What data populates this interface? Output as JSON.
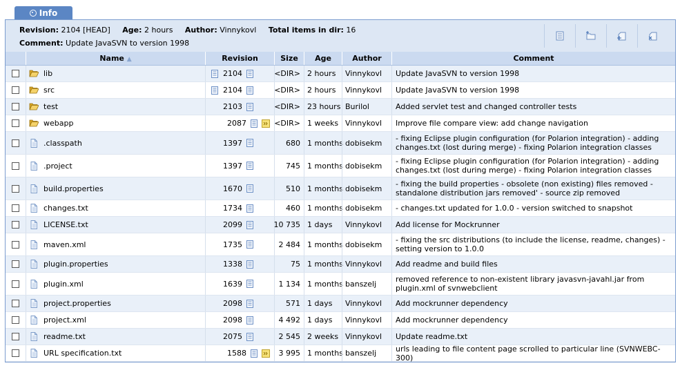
{
  "tab": {
    "label": "Info"
  },
  "info": {
    "revision_label": "Revision:",
    "revision_value": "2104 [HEAD]",
    "age_label": "Age:",
    "age_value": "2 hours",
    "author_label": "Author:",
    "author_value": "Vinnykovl",
    "total_label": "Total items in dir:",
    "total_value": "16",
    "comment_label": "Comment:",
    "comment_value": "Update JavaSVN to version 1998"
  },
  "toolbar": [
    "list-icon",
    "folder-add-icon",
    "file-add-icon",
    "delete-icon"
  ],
  "columns": {
    "name": "Name",
    "revision": "Revision",
    "size": "Size",
    "age": "Age",
    "author": "Author",
    "comment": "Comment"
  },
  "colors": {
    "accent": "#5b86c4",
    "header": "#cbdaf0",
    "alt_row": "#e9f0f9",
    "folder": "#e9c24a"
  },
  "rows": [
    {
      "type": "dir",
      "name": "lib",
      "revision": "2104",
      "head_log": true,
      "diff": false,
      "size": "<DIR>",
      "age": "2 hours",
      "author": "Vinnykovl",
      "comment": "Update JavaSVN to version 1998",
      "h": 24
    },
    {
      "type": "dir",
      "name": "src",
      "revision": "2104",
      "head_log": true,
      "diff": false,
      "size": "<DIR>",
      "age": "2 hours",
      "author": "Vinnykovl",
      "comment": "Update JavaSVN to version 1998",
      "h": 24
    },
    {
      "type": "dir",
      "name": "test",
      "revision": "2103",
      "head_log": false,
      "diff": false,
      "size": "<DIR>",
      "age": "23 hours",
      "author": "Burilol",
      "comment": "Added servlet test and changed controller tests",
      "h": 24
    },
    {
      "type": "dir",
      "name": "webapp",
      "revision": "2087",
      "head_log": false,
      "diff": true,
      "size": "<DIR>",
      "age": "1 weeks",
      "author": "Vinnykovl",
      "comment": "Improve file compare view: add change navigation",
      "h": 24
    },
    {
      "type": "file",
      "name": ".classpath",
      "revision": "1397",
      "head_log": false,
      "diff": false,
      "size": "680",
      "age": "1 months",
      "author": "dobisekm",
      "comment": "- fixing Eclipse plugin configuration (for Polarion integration) - adding changes.txt (lost during merge) - fixing Polarion integration classes",
      "h": 33
    },
    {
      "type": "file",
      "name": ".project",
      "revision": "1397",
      "head_log": false,
      "diff": false,
      "size": "745",
      "age": "1 months",
      "author": "dobisekm",
      "comment": "- fixing Eclipse plugin configuration (for Polarion integration) - adding changes.txt (lost during merge) - fixing Polarion integration classes",
      "h": 33
    },
    {
      "type": "file",
      "name": "build.properties",
      "revision": "1670",
      "head_log": false,
      "diff": false,
      "size": "510",
      "age": "1 months",
      "author": "dobisekm",
      "comment": "- fixing the build properties - obsolete (non existing) files removed - standalone distribution jars removed' - source zip removed",
      "h": 33
    },
    {
      "type": "file",
      "name": "changes.txt",
      "revision": "1734",
      "head_log": false,
      "diff": false,
      "size": "460",
      "age": "1 months",
      "author": "dobisekm",
      "comment": "- changes.txt updated for 1.0.0 - version switched to snapshot",
      "h": 24
    },
    {
      "type": "file",
      "name": "LICENSE.txt",
      "revision": "2099",
      "head_log": false,
      "diff": false,
      "size": "10 735",
      "age": "1 days",
      "author": "Vinnykovl",
      "comment": "Add license for Mockrunner",
      "h": 24
    },
    {
      "type": "file",
      "name": "maven.xml",
      "revision": "1735",
      "head_log": false,
      "diff": false,
      "size": "2 484",
      "age": "1 months",
      "author": "dobisekm",
      "comment": "- fixing the src distributions (to include the license, readme, changes) - setting version to 1.0.0",
      "h": 33
    },
    {
      "type": "file",
      "name": "plugin.properties",
      "revision": "1338",
      "head_log": false,
      "diff": false,
      "size": "75",
      "age": "1 months",
      "author": "Vinnykovl",
      "comment": "Add readme and build files",
      "h": 24
    },
    {
      "type": "file",
      "name": "plugin.xml",
      "revision": "1639",
      "head_log": false,
      "diff": false,
      "size": "1 134",
      "age": "1 months",
      "author": "banszelj",
      "comment": "removed reference to non-existent library javasvn-javahl.jar from plugin.xml of svnwebclient",
      "h": 33
    },
    {
      "type": "file",
      "name": "project.properties",
      "revision": "2098",
      "head_log": false,
      "diff": false,
      "size": "571",
      "age": "1 days",
      "author": "Vinnykovl",
      "comment": "Add mockrunner dependency",
      "h": 24
    },
    {
      "type": "file",
      "name": "project.xml",
      "revision": "2098",
      "head_log": false,
      "diff": false,
      "size": "4 492",
      "age": "1 days",
      "author": "Vinnykovl",
      "comment": "Add mockrunner dependency",
      "h": 24
    },
    {
      "type": "file",
      "name": "readme.txt",
      "revision": "2075",
      "head_log": false,
      "diff": false,
      "size": "2 545",
      "age": "2 weeks",
      "author": "Vinnykovl",
      "comment": "Update readme.txt",
      "h": 24
    },
    {
      "type": "file",
      "name": "URL specification.txt",
      "revision": "1588",
      "head_log": false,
      "diff": true,
      "size": "3 995",
      "age": "1 months",
      "author": "banszelj",
      "comment": "urls leading to file content page scrolled to particular line (SVNWEBC-300)",
      "h": 24
    }
  ]
}
